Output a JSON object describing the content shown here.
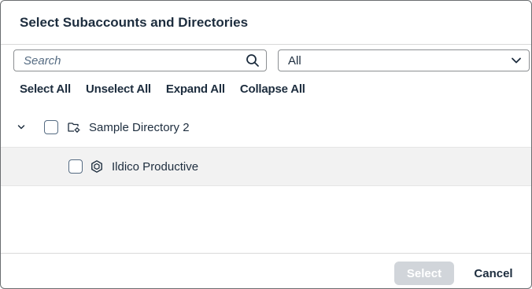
{
  "dialog": {
    "title": "Select Subaccounts and Directories"
  },
  "search": {
    "placeholder": "Search",
    "icon": "search-icon"
  },
  "filter": {
    "selected": "All",
    "icon": "chevron-down-icon"
  },
  "toolbar": {
    "select_all": "Select All",
    "unselect_all": "Unselect All",
    "expand_all": "Expand All",
    "collapse_all": "Collapse All"
  },
  "tree": {
    "items": [
      {
        "label": "Sample Directory 2",
        "icon": "directory-icon",
        "expanded": true,
        "checked": false
      },
      {
        "label": "Ildico Productive",
        "icon": "subaccount-icon",
        "checked": false
      }
    ]
  },
  "footer": {
    "select_label": "Select",
    "cancel_label": "Cancel"
  },
  "colors": {
    "text": "#1d2d3e",
    "border": "#8c8f92",
    "row_highlight": "#f2f2f2",
    "disabled_button": "#d1d5da"
  }
}
